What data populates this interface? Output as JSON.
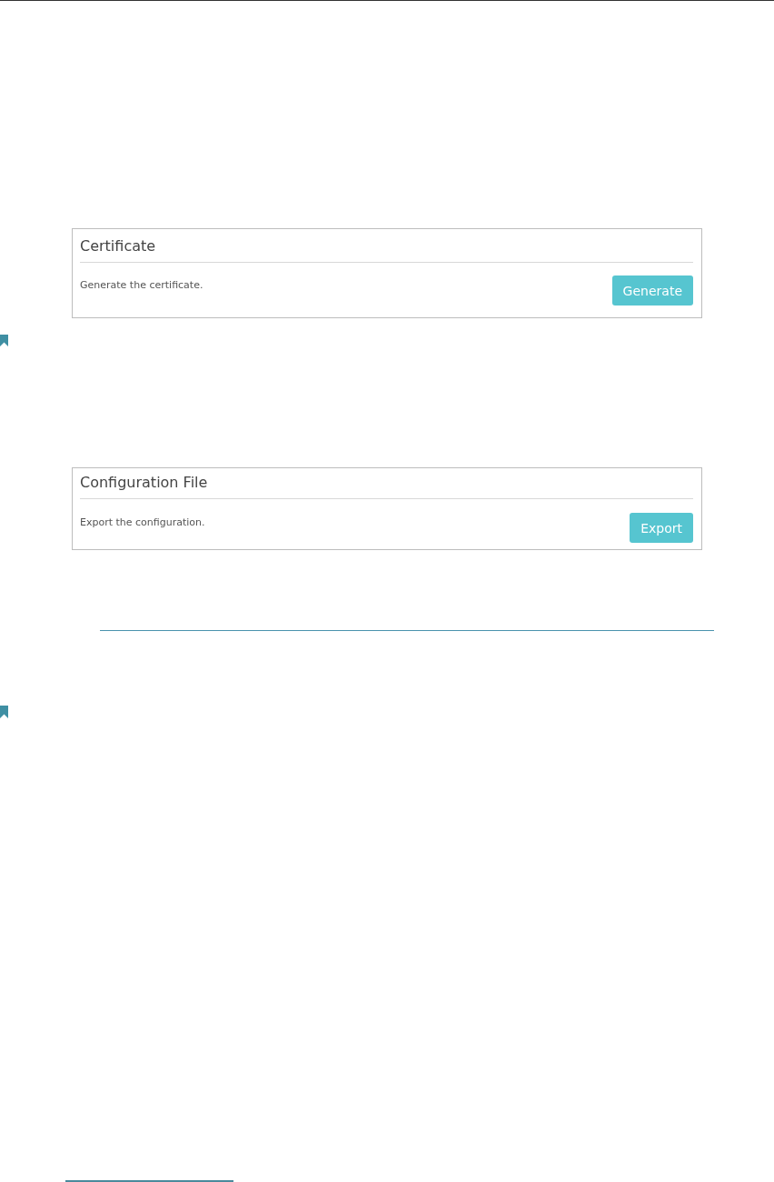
{
  "panels": [
    {
      "title": "Certificate",
      "description": "Generate the certificate.",
      "button": "Generate"
    },
    {
      "title": "Configuration File",
      "description": "Export the configuration.",
      "button": "Export"
    }
  ]
}
